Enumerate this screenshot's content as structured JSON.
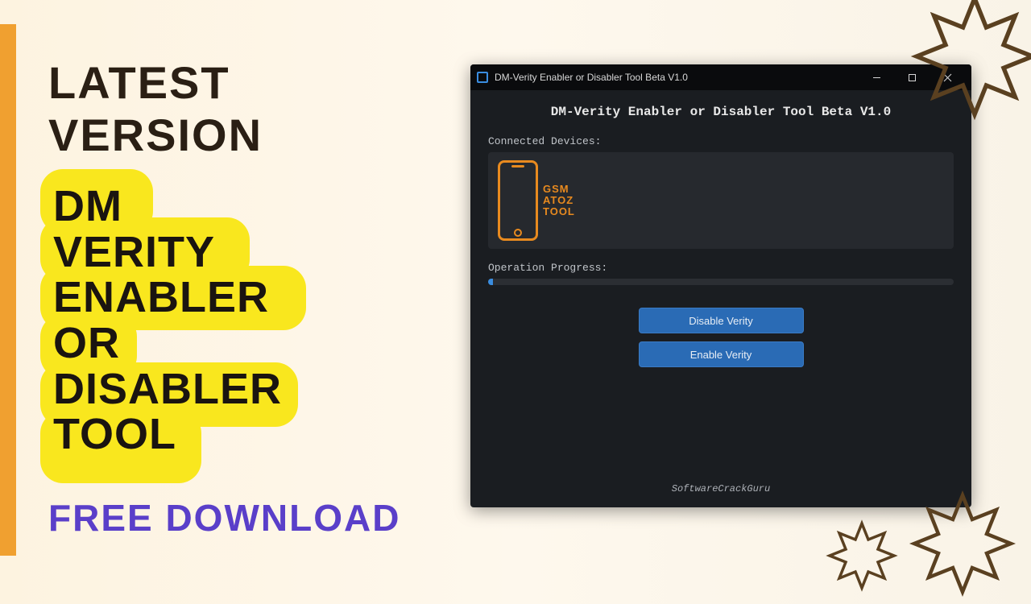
{
  "banner": {
    "latest_version": "LATEST VERSION",
    "tool_name": "DM\nVERITY\nENABLER\nOR\nDISABLER\nTOOL",
    "free_download": "FREE DOWNLOAD"
  },
  "window": {
    "titlebar_text": "DM-Verity Enabler or Disabler Tool Beta V1.0",
    "app_title": "DM-Verity Enabler or Disabler Tool Beta V1.0",
    "connected_label": "Connected Devices:",
    "logo_line1": "GSM",
    "logo_line2": "ATOZ",
    "logo_line3": "TOOL",
    "progress_label": "Operation Progress:",
    "disable_btn": "Disable Verity",
    "enable_btn": "Enable Verity",
    "footer": "SoftwareCrackGuru"
  },
  "colors": {
    "accent_yellow": "#f9e71e",
    "accent_orange": "#f0a030",
    "accent_purple": "#5a3fc9",
    "btn_blue": "#2a6bb5",
    "logo_orange": "#e88a1f",
    "deco_brown": "#5a4020"
  }
}
